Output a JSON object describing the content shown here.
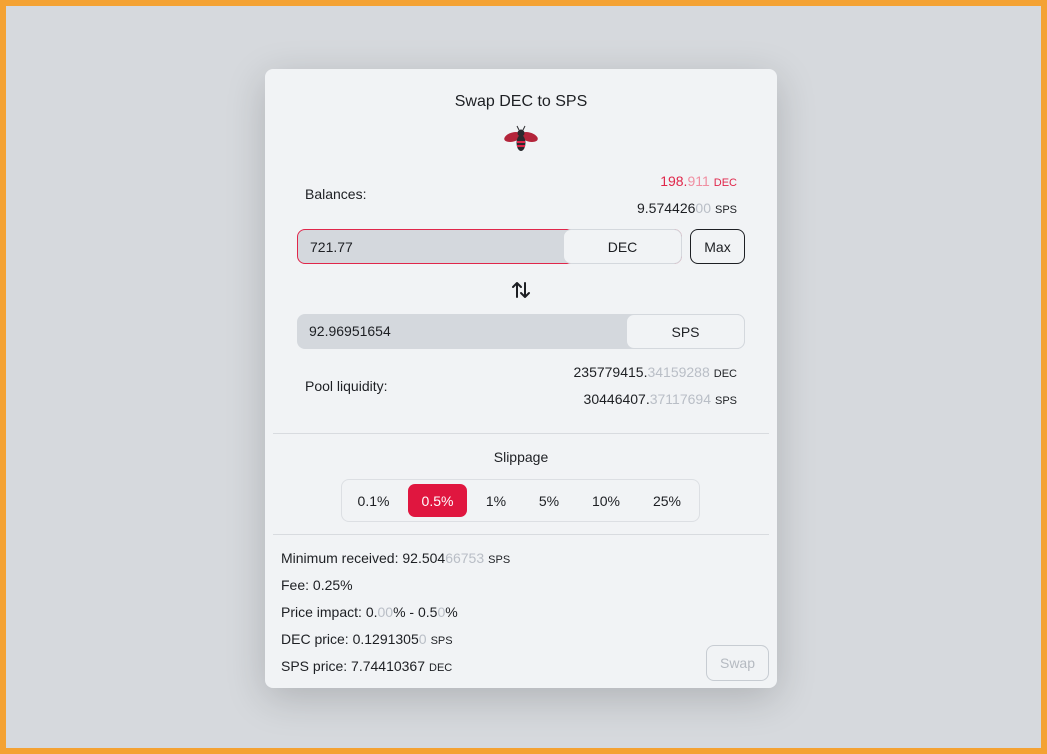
{
  "title": "Swap DEC to SPS",
  "balances": {
    "label": "Balances:",
    "dec": {
      "main": "198.",
      "faded": "911",
      "unit": "DEC"
    },
    "sps": {
      "main": "9.574426",
      "faded": "00",
      "unit": "SPS"
    }
  },
  "input": {
    "value": "721.77",
    "token": "DEC",
    "max_label": "Max"
  },
  "output": {
    "value": "92.96951654",
    "token": "SPS"
  },
  "pool": {
    "label": "Pool liquidity:",
    "dec": {
      "main": "235779415.",
      "faded": "34159288",
      "unit": "DEC"
    },
    "sps": {
      "main": "30446407.",
      "faded": "37117694",
      "unit": "SPS"
    }
  },
  "slippage": {
    "title": "Slippage",
    "options": [
      "0.1%",
      "0.5%",
      "1%",
      "5%",
      "10%",
      "25%"
    ],
    "selected": "0.5%"
  },
  "info": {
    "min_received": {
      "label": "Minimum received: ",
      "main": "92.504",
      "faded": "66753",
      "unit": "SPS"
    },
    "fee": {
      "label": "Fee: ",
      "value": "0.25%"
    },
    "price_impact": {
      "label": "Price impact: ",
      "a1": "0.",
      "a2": "00",
      "a3": "% - 0.5",
      "a4": "0",
      "a5": "%"
    },
    "dec_price": {
      "label": "DEC price: ",
      "main": "0.1291305",
      "faded": "0",
      "unit": "SPS"
    },
    "sps_price": {
      "label": "SPS price: ",
      "main": "7.74410367",
      "unit": "DEC"
    }
  },
  "swap_label": "Swap",
  "colors": {
    "accent": "#e0163f",
    "frame": "#f4a233",
    "card": "#f1f3f5"
  }
}
